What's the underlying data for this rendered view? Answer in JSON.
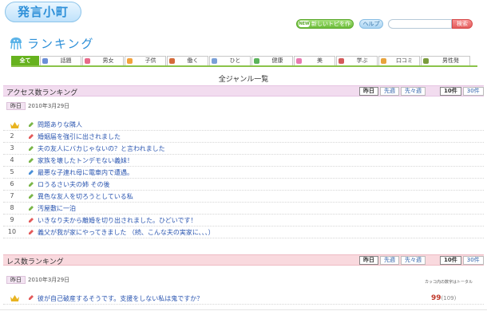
{
  "header": {
    "logo_text": "発言小町",
    "new_topic_badge": "NEW",
    "new_topic_label": "新しいトピを作成",
    "help_label": "ヘルプ",
    "search_placeholder": "",
    "search_label": "検索"
  },
  "ranking_title": "ランキング",
  "tabs": [
    {
      "label": "全て",
      "active": true,
      "icon_color": "#66b21e"
    },
    {
      "label": "話題",
      "icon_color": "#6b8fd8"
    },
    {
      "label": "男女",
      "icon_color": "#e86a8a"
    },
    {
      "label": "子供",
      "icon_color": "#f2a23c"
    },
    {
      "label": "働く",
      "icon_color": "#d46a3a"
    },
    {
      "label": "ひと",
      "icon_color": "#7aa0d8"
    },
    {
      "label": "健康",
      "icon_color": "#5bb45b"
    },
    {
      "label": "美",
      "icon_color": "#e87ab0"
    },
    {
      "label": "学ぶ",
      "icon_color": "#d45a5a"
    },
    {
      "label": "口コミ",
      "icon_color": "#e8a43c"
    },
    {
      "label": "男性発",
      "icon_color": "#7a9c3c"
    }
  ],
  "genre_heading": "全ジャンル一覧",
  "access_ranking": {
    "title": "アクセス数ランキング",
    "periods": [
      "昨日",
      "先週",
      "先々週"
    ],
    "counts": [
      "10件",
      "30件"
    ],
    "date_tag": "昨日",
    "date": "2010年3月29日",
    "items": [
      {
        "rank": "1",
        "title": "問題ありな隣人",
        "crown": true,
        "icon": "green"
      },
      {
        "rank": "2",
        "title": "婚姻届を強引に出されました",
        "icon": "red"
      },
      {
        "rank": "3",
        "title": "夫の友人にバカじゃないの？と言われました",
        "icon": "green"
      },
      {
        "rank": "4",
        "title": "家族を壊したトンデモない義妹！",
        "icon": "green"
      },
      {
        "rank": "5",
        "title": "最悪な子連れ母に電車内で遭遇。",
        "icon": "blue"
      },
      {
        "rank": "6",
        "title": "ロうるさい夫の姉 その後",
        "icon": "green"
      },
      {
        "rank": "7",
        "title": "異色な友人を切ろうとしている私",
        "icon": "green"
      },
      {
        "rank": "8",
        "title": "汚屋敷に一泊",
        "icon": "green"
      },
      {
        "rank": "9",
        "title": "いきなり夫から離婚を切り出されました。ひどいです！",
        "icon": "red"
      },
      {
        "rank": "10",
        "title": "義父が我が家にやってきました （続、こんな夫の実家に、、、）",
        "icon": "red"
      }
    ]
  },
  "res_ranking": {
    "title": "レス数ランキング",
    "periods": [
      "昨日",
      "先週",
      "先々週"
    ],
    "counts": [
      "10件",
      "30件"
    ],
    "date_tag": "昨日",
    "date": "2010年3月29日",
    "tally_note": "カッコ内の数字はトータル",
    "items": [
      {
        "rank": "1",
        "title": "彼が自己破産するそうです。支援をしない私は鬼ですか？",
        "count": "99",
        "total": "(109)"
      }
    ]
  },
  "colors": {
    "accent": "#2c8fd8",
    "tab_active": "#66b21e",
    "access_bar": "#f2dcef",
    "res_bar": "#f9d9de",
    "link": "#2a55b0"
  }
}
